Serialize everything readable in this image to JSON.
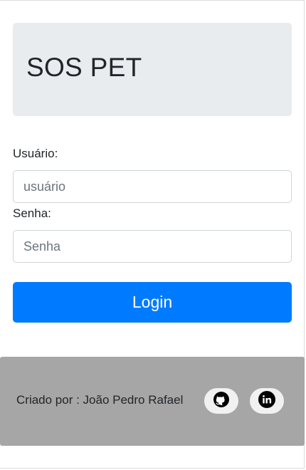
{
  "header": {
    "title": "SOS PET"
  },
  "login_form": {
    "username_label": "Usuário:",
    "username_placeholder": "usuário",
    "username_value": "",
    "password_label": "Senha:",
    "password_placeholder": "Senha",
    "password_value": "",
    "submit_label": "Login"
  },
  "footer": {
    "credit_text": "Criado por : João Pedro Rafael",
    "links": [
      {
        "icon": "github-icon"
      },
      {
        "icon": "linkedin-icon"
      }
    ]
  },
  "colors": {
    "primary": "#007bff",
    "header_bg": "#e9ecef",
    "footer_bg": "#a6a6a6"
  }
}
